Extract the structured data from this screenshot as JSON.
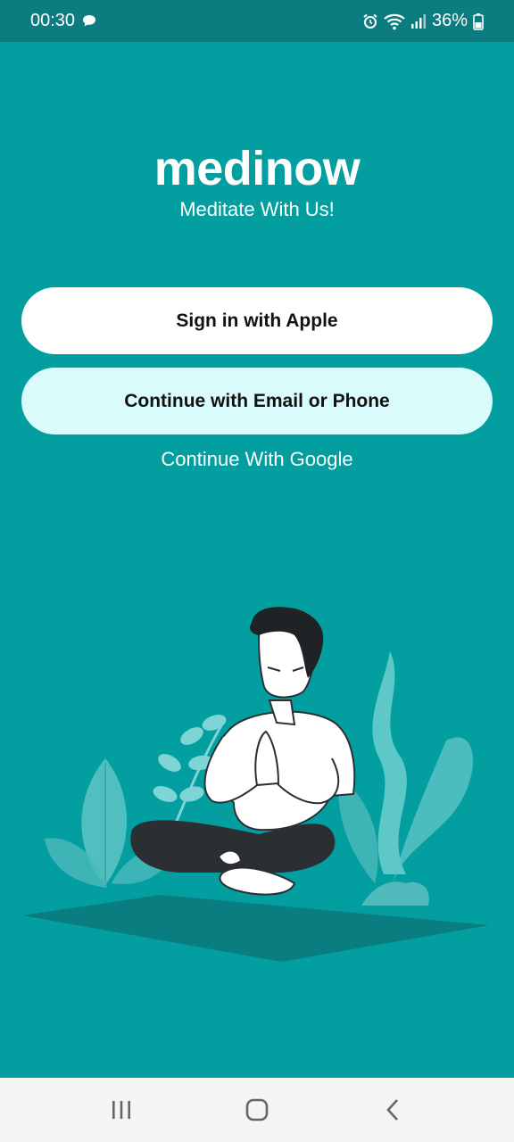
{
  "status_bar": {
    "time": "00:30",
    "battery": "36%",
    "icons": [
      "chat-bubble-icon",
      "alarm-icon",
      "wifi-icon",
      "signal-icon",
      "battery-icon"
    ]
  },
  "brand": {
    "app_name": "medinow",
    "tagline": "Meditate With Us!"
  },
  "auth": {
    "apple_label": "Sign in with Apple",
    "email_label": "Continue with Email or Phone",
    "google_label": "Continue With Google"
  },
  "nav_bar": {
    "icons": [
      "recent-apps-icon",
      "home-icon",
      "back-icon"
    ]
  },
  "colors": {
    "background": "#039ea0",
    "status_bar": "#0b7d80",
    "apple_button": "#ffffff",
    "email_button": "#d9fbfc"
  }
}
